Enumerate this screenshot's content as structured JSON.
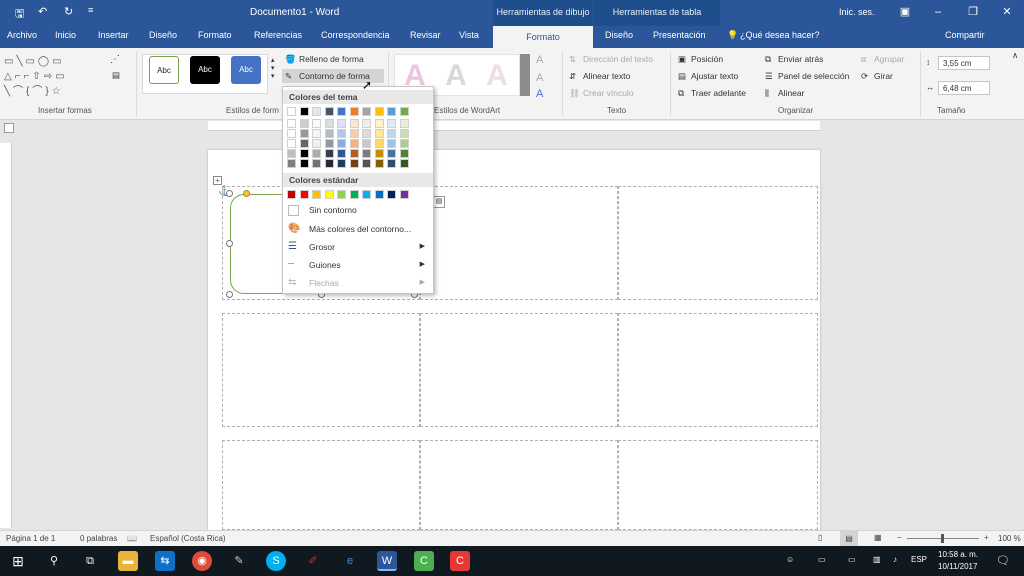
{
  "titlebar": {
    "title": "Documento1 - Word",
    "context_drawing": "Herramientas de dibujo",
    "context_table": "Herramientas de tabla",
    "signin": "Inic. ses.",
    "save_icon": "save-icon",
    "undo_icon": "undo-icon",
    "redo_icon": "redo-icon"
  },
  "tabs": [
    "Archivo",
    "Inicio",
    "Insertar",
    "Diseño",
    "Formato",
    "Referencias",
    "Correspondencia",
    "Revisar",
    "Vista"
  ],
  "active_tab": "Formato",
  "context_tabs": [
    "Diseño",
    "Presentación"
  ],
  "tell_me": "¿Qué desea hacer?",
  "share": "Compartir",
  "ribbon": {
    "groups": {
      "insert_shapes": "Insertar formas",
      "shape_styles": "Estilos de form",
      "wordart": "Estilos de WordArt",
      "text": "Texto",
      "arrange": "Organizar",
      "size": "Tamaño"
    },
    "style_samples": [
      "Abc",
      "Abc",
      "Abc"
    ],
    "fill": "Relleno de forma",
    "outline": "Contorno de forma",
    "text_direction": "Dirección del texto",
    "align_text": "Alinear texto",
    "create_link": "Crear vínculo",
    "position": "Posición",
    "wrap_text": "Ajustar texto",
    "bring_forward": "Traer adelante",
    "send_backward": "Enviar atrás",
    "selection_pane": "Panel de selección",
    "align": "Alinear",
    "group": "Agrupar",
    "rotate": "Girar",
    "height": "3,55 cm",
    "width": "6,48 cm",
    "wordart_letter": "A"
  },
  "outline_menu": {
    "theme_colors": "Colores del tema",
    "standard_colors": "Colores estándar",
    "no_outline": "Sin contorno",
    "more_colors": "Más colores del contorno...",
    "weight": "Grosor",
    "dashes": "Guiones",
    "arrows": "Flechas",
    "theme_top": [
      "#ffffff",
      "#000000",
      "#e7e6e6",
      "#44546a",
      "#4472c4",
      "#ed7d31",
      "#a5a5a5",
      "#ffc000",
      "#5b9bd5",
      "#70ad47"
    ],
    "standard": [
      "#c00000",
      "#ff0000",
      "#ffc000",
      "#ffff00",
      "#92d050",
      "#00b050",
      "#00b0f0",
      "#0070c0",
      "#002060",
      "#7030a0"
    ]
  },
  "status": {
    "page": "Página 1 de 1",
    "words": "0 palabras",
    "language": "Español (Costa Rica)",
    "zoom": "100 %"
  },
  "taskbar": {
    "lang": "ESP",
    "time": "10:58 a. m.",
    "date": "10/11/2017"
  }
}
